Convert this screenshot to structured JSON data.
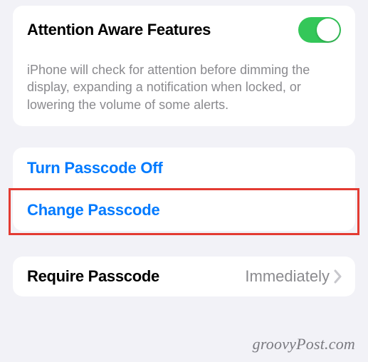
{
  "attention": {
    "title": "Attention Aware Features",
    "toggle_on": true,
    "description": "iPhone will check for attention before dimming the display, expanding a notification when locked, or lowering the volume of some alerts."
  },
  "passcode": {
    "turn_off_label": "Turn Passcode Off",
    "change_label": "Change Passcode"
  },
  "require": {
    "label": "Require Passcode",
    "value": "Immediately"
  },
  "watermark": "groovyPost.com"
}
